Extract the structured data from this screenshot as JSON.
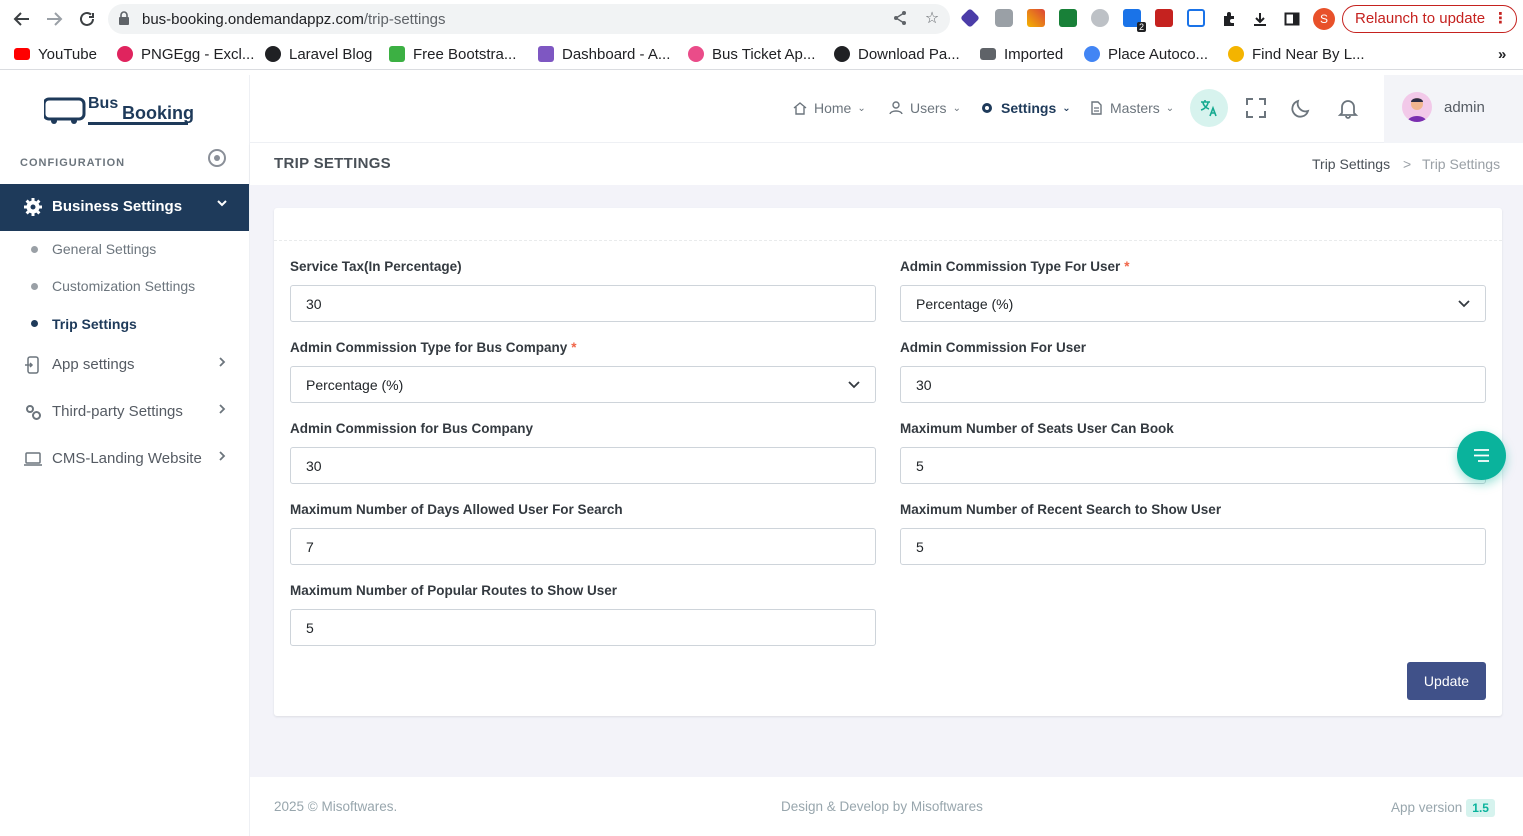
{
  "browser": {
    "url_host": "bus-booking.ondemandappz.com",
    "url_path": "/trip-settings",
    "relaunch_label": "Relaunch to update",
    "profile_initial": "S",
    "ext_badge": "2"
  },
  "bookmarks": [
    {
      "label": "YouTube",
      "color": "#ff0000"
    },
    {
      "label": "PNGEgg - Excl...",
      "color": "#e0245e"
    },
    {
      "label": "Laravel Blog",
      "color": "#202124"
    },
    {
      "label": "Free Bootstra...",
      "color": "#3cb043"
    },
    {
      "label": "Dashboard - A...",
      "color": "#7e57c2"
    },
    {
      "label": "Bus Ticket Ap...",
      "color": "#ea4c89"
    },
    {
      "label": "Download Pa...",
      "color": "#202124"
    },
    {
      "label": "Imported",
      "color": "#5f6368"
    },
    {
      "label": "Place Autoco...",
      "color": "#4285f4"
    },
    {
      "label": "Find Near By L...",
      "color": "#f4b400"
    }
  ],
  "bookmarks_more": "»",
  "logo": {
    "line1": "Bus",
    "line2": "Booking"
  },
  "sidebar": {
    "section_label": "CONFIGURATION",
    "active_group": "Business Settings",
    "subitems": [
      "General Settings",
      "Customization Settings",
      "Trip Settings"
    ],
    "items": [
      "App settings",
      "Third-party Settings",
      "CMS-Landing Website"
    ]
  },
  "topnav": {
    "home": "Home",
    "users": "Users",
    "settings": "Settings",
    "masters": "Masters",
    "user_name": "admin"
  },
  "page": {
    "title": "TRIP SETTINGS",
    "breadcrumb": [
      "Trip Settings",
      "Trip Settings"
    ],
    "breadcrumb_sep": ">"
  },
  "form": {
    "service_tax": {
      "label": "Service Tax(In Percentage)",
      "value": "30"
    },
    "admin_commission_type_user": {
      "label": "Admin Commission Type For User",
      "value": "Percentage (%)",
      "required_mark": "*"
    },
    "admin_commission_type_company": {
      "label": "Admin Commission Type for Bus Company",
      "value": "Percentage (%)",
      "required_mark": "*"
    },
    "admin_commission_user": {
      "label": "Admin Commission For User",
      "value": "30"
    },
    "admin_commission_company": {
      "label": "Admin Commission for Bus Company",
      "value": "30"
    },
    "max_seats": {
      "label": "Maximum Number of Seats User Can Book",
      "value": "5"
    },
    "max_days": {
      "label": "Maximum Number of Days Allowed User For Search",
      "value": "7"
    },
    "max_recent": {
      "label": "Maximum Number of Recent Search to Show User",
      "value": "5"
    },
    "max_popular": {
      "label": "Maximum Number of Popular Routes to Show User",
      "value": "5"
    },
    "update_label": "Update"
  },
  "footer": {
    "copyright": "2025 © Misoftwares.",
    "credit": "Design & Develop by Misoftwares",
    "version_label": "App version",
    "version": "1.5"
  },
  "colors": {
    "primary": "#405189",
    "sidebar_active": "#1e3a5a",
    "accent": "#0ab39c",
    "required": "#f06548"
  }
}
